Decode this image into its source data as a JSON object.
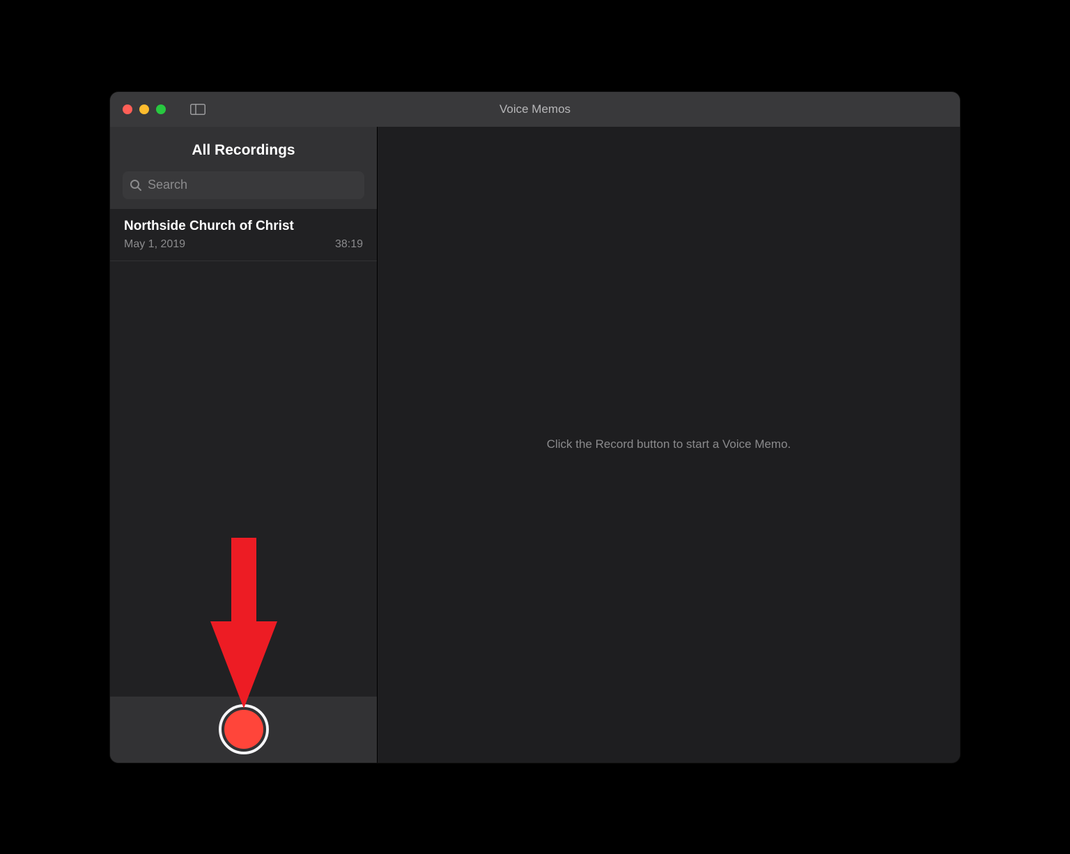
{
  "window": {
    "title": "Voice Memos"
  },
  "sidebar": {
    "heading": "All Recordings",
    "search_placeholder": "Search"
  },
  "recordings": [
    {
      "title": "Northside Church of Christ",
      "date": "May 1, 2019",
      "duration": "38:19"
    }
  ],
  "main": {
    "placeholder": "Click the Record button to start a Voice Memo."
  },
  "colors": {
    "record_red": "#ff453a",
    "annotation_red": "#ed1c24"
  }
}
